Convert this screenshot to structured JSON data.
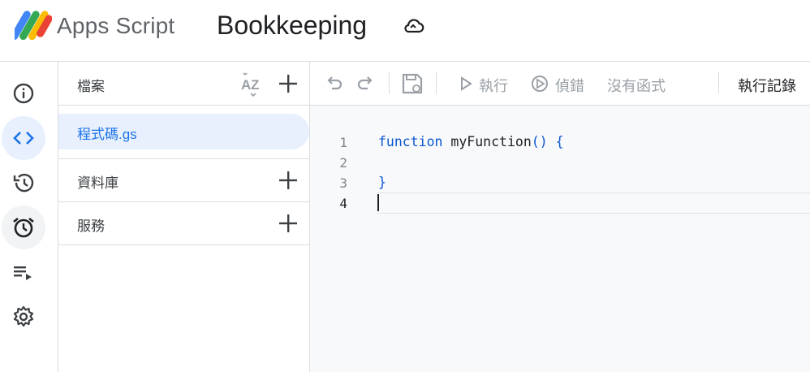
{
  "header": {
    "app_name": "Apps Script",
    "project_title": "Bookkeeping",
    "save_status_icon": "cloud-sync-icon"
  },
  "rail": {
    "items": [
      {
        "name": "overview",
        "icon": "info-icon"
      },
      {
        "name": "editor",
        "icon": "code-icon",
        "active": true
      },
      {
        "name": "executions",
        "icon": "history-icon"
      },
      {
        "name": "triggers",
        "icon": "alarm-icon"
      },
      {
        "name": "executions-list",
        "icon": "playlist-play-icon"
      },
      {
        "name": "settings",
        "icon": "gear-icon"
      }
    ]
  },
  "files": {
    "title": "檔案",
    "items": [
      {
        "name": "程式碼.gs",
        "active": true
      }
    ],
    "libraries_label": "資料庫",
    "services_label": "服務"
  },
  "toolbar": {
    "run_label": "執行",
    "debug_label": "偵錯",
    "function_select": "沒有函式",
    "log_label": "執行記錄"
  },
  "editor": {
    "line_numbers": [
      "1",
      "2",
      "3",
      "4"
    ],
    "lines": [
      {
        "keyword": "function",
        "name": " myFunction",
        "punct": "() {"
      },
      {
        "text": ""
      },
      {
        "text": "}"
      },
      {
        "text": ""
      }
    ],
    "current_line": 4
  },
  "colors": {
    "accent": "#1a73e8",
    "active_bg": "#e8f0fe",
    "keyword": "#0b57d0",
    "editor_bg": "#f8f9fa",
    "border": "#dadce0"
  }
}
